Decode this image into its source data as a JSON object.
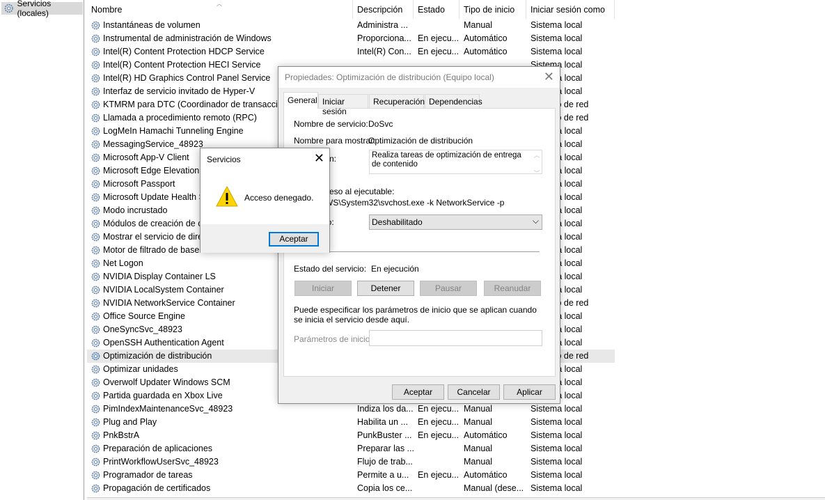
{
  "tree": {
    "root_label": "Servicios (locales)"
  },
  "columns": {
    "name": "Nombre",
    "description": "Descripción",
    "state": "Estado",
    "startup": "Tipo de inicio",
    "logon": "Iniciar sesión como"
  },
  "rows": [
    {
      "name": "Instantáneas de volumen",
      "desc": "Administra ...",
      "state": "",
      "startup": "Manual",
      "logon": "Sistema local"
    },
    {
      "name": "Instrumental de administración de Windows",
      "desc": "Proporciona...",
      "state": "En ejecu...",
      "startup": "Automático",
      "logon": "Sistema local"
    },
    {
      "name": "Intel(R) Content Protection HDCP Service",
      "desc": "Intel(R) Con...",
      "state": "En ejecu...",
      "startup": "Automático",
      "logon": "Sistema local"
    },
    {
      "name": "Intel(R) Content Protection HECI Service",
      "desc": "",
      "state": "",
      "startup": "",
      "logon": "Sistema local"
    },
    {
      "name": "Intel(R) HD Graphics Control Panel Service",
      "desc": "",
      "state": "",
      "startup": "",
      "logon": "Sistema local"
    },
    {
      "name": "Interfaz de servicio invitado de Hyper-V",
      "desc": "",
      "state": "",
      "startup": "",
      "logon": "Sistema local"
    },
    {
      "name": "KTMRM para DTC (Coordinador de transacciones",
      "desc": "",
      "state": "",
      "startup": "",
      "logon": "Servicio de red"
    },
    {
      "name": "Llamada a procedimiento remoto (RPC)",
      "desc": "",
      "state": "",
      "startup": "",
      "logon": "Servicio de red"
    },
    {
      "name": "LogMeIn Hamachi Tunneling Engine",
      "desc": "",
      "state": "",
      "startup": "",
      "logon": "Sistema local"
    },
    {
      "name": "MessagingService_48923",
      "desc": "",
      "state": "",
      "startup": "",
      "logon": "Sistema local"
    },
    {
      "name": "Microsoft App-V Client",
      "desc": "",
      "state": "",
      "startup": "",
      "logon": "Sistema local"
    },
    {
      "name": "Microsoft Edge Elevation Service",
      "desc": "",
      "state": "",
      "startup": "",
      "logon": "Sistema local"
    },
    {
      "name": "Microsoft Passport",
      "desc": "",
      "state": "",
      "startup": "",
      "logon": "Sistema local"
    },
    {
      "name": "Microsoft Update Health Service",
      "desc": "",
      "state": "",
      "startup": "",
      "logon": "Sistema local"
    },
    {
      "name": "Modo incrustado",
      "desc": "",
      "state": "",
      "startup": "",
      "logon": "Sistema local"
    },
    {
      "name": "Módulos de creación de claves",
      "desc": "",
      "state": "",
      "startup": "",
      "logon": "Sistema local"
    },
    {
      "name": "Mostrar el servicio de directivas",
      "desc": "",
      "state": "",
      "startup": "",
      "logon": "Sistema local"
    },
    {
      "name": "Motor de filtrado de base",
      "desc": "",
      "state": "",
      "startup": "",
      "logon": "Sistema local"
    },
    {
      "name": "Net Logon",
      "desc": "",
      "state": "",
      "startup": "",
      "logon": "Sistema local"
    },
    {
      "name": "NVIDIA Display Container LS",
      "desc": "",
      "state": "",
      "startup": "",
      "logon": "Sistema local"
    },
    {
      "name": "NVIDIA LocalSystem Container",
      "desc": "",
      "state": "",
      "startup": "",
      "logon": "Sistema local"
    },
    {
      "name": "NVIDIA NetworkService Container",
      "desc": "",
      "state": "",
      "startup": "",
      "logon": "Servicio de red"
    },
    {
      "name": "Office  Source Engine",
      "desc": "",
      "state": "",
      "startup": "",
      "logon": "Sistema local"
    },
    {
      "name": "OneSyncSvc_48923",
      "desc": "",
      "state": "",
      "startup": "",
      "logon": "Sistema local"
    },
    {
      "name": "OpenSSH Authentication Agent",
      "desc": "",
      "state": "",
      "startup": "",
      "logon": "Sistema local"
    },
    {
      "name": "Optimización de distribución",
      "desc": "",
      "state": "",
      "startup": "",
      "logon": "Servicio de red",
      "selected": true
    },
    {
      "name": "Optimizar unidades",
      "desc": "",
      "state": "",
      "startup": "",
      "logon": "Sistema local"
    },
    {
      "name": "Overwolf Updater Windows SCM",
      "desc": "",
      "state": "",
      "startup": "",
      "logon": "Sistema local"
    },
    {
      "name": "Partida guardada en Xbox Live",
      "desc": "",
      "state": "",
      "startup": "",
      "logon": "Sistema local"
    },
    {
      "name": "PimIndexMaintenanceSvc_48923",
      "desc": "Indiza los da...",
      "state": "En ejecu...",
      "startup": "Manual",
      "logon": "Sistema local"
    },
    {
      "name": "Plug and Play",
      "desc": "Habilita un ...",
      "state": "En ejecu...",
      "startup": "Manual",
      "logon": "Sistema local"
    },
    {
      "name": "PnkBstrA",
      "desc": "PunkBuster ...",
      "state": "En ejecu...",
      "startup": "Automático",
      "logon": "Sistema local"
    },
    {
      "name": "Preparación de aplicaciones",
      "desc": "Preparar las ...",
      "state": "",
      "startup": "Manual",
      "logon": "Sistema local"
    },
    {
      "name": "PrintWorkflowUserSvc_48923",
      "desc": "Flujo de trab...",
      "state": "",
      "startup": "Manual",
      "logon": "Sistema local"
    },
    {
      "name": "Programador de tareas",
      "desc": "Permite a u...",
      "state": "En ejecu...",
      "startup": "Automático",
      "logon": "Sistema local"
    },
    {
      "name": "Propagación de certificados",
      "desc": "Copia los ce...",
      "state": "",
      "startup": "Manual (dese...",
      "logon": "Sistema local"
    }
  ],
  "props": {
    "title": "Propiedades: Optimización de distribución (Equipo local)",
    "tabs": [
      "General",
      "Iniciar sesión",
      "Recuperación",
      "Dependencias"
    ],
    "service_name_label": "Nombre de servicio:",
    "service_name_value": "DoSvc",
    "display_name_label": "Nombre para mostrar:",
    "display_name_value": "Optimización de distribución",
    "description_label_visible": "n:",
    "description_value": "Realiza tareas de optimización de entrega de contenido",
    "path_label_visible": "ceso al ejecutable:",
    "path_value_visible": "WS\\System32\\svchost.exe -k NetworkService -p",
    "startup_label_visible": "io:",
    "startup_value": "Deshabilitado",
    "status_label": "Estado del servicio:",
    "status_value": "En ejecución",
    "btn_start": "Iniciar",
    "btn_stop": "Detener",
    "btn_pause": "Pausar",
    "btn_resume": "Reanudar",
    "params_help": "Puede especificar los parámetros de inicio que se aplican cuando se inicia el servicio desde aquí.",
    "params_label": "Parámetros de inicio:",
    "params_value": "",
    "ok": "Aceptar",
    "cancel": "Cancelar",
    "apply": "Aplicar"
  },
  "msgbox": {
    "title": "Servicios",
    "text": "Acceso denegado.",
    "ok": "Aceptar",
    "icon": "warning-icon"
  },
  "colors": {
    "accent": "#0078d7",
    "warning": "#ffd400",
    "selected_row": "#e8e8e8"
  }
}
